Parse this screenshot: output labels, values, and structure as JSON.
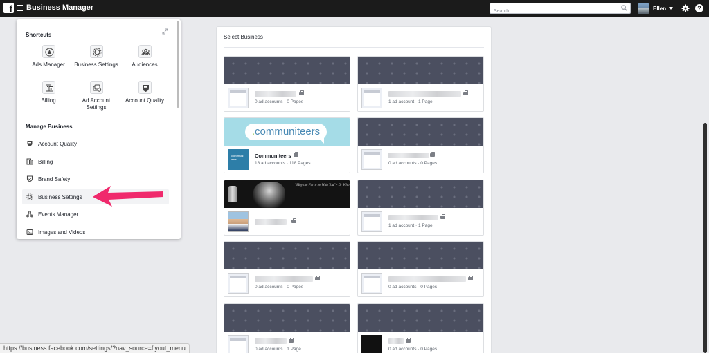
{
  "topbar": {
    "title": "Business Manager",
    "search_placeholder": "Search",
    "user_name": "Ellen",
    "help_glyph": "?"
  },
  "flyout": {
    "shortcuts_heading": "Shortcuts",
    "shortcuts": [
      {
        "label": "Ads Manager",
        "icon": "ads-manager-icon"
      },
      {
        "label": "Business Settings",
        "icon": "gear-icon"
      },
      {
        "label": "Audiences",
        "icon": "people-icon"
      },
      {
        "label": "Billing",
        "icon": "billing-icon"
      },
      {
        "label": "Ad Account Settings",
        "icon": "ad-account-settings-icon"
      },
      {
        "label": "Account Quality",
        "icon": "shield-icon"
      }
    ],
    "manage_heading": "Manage Business",
    "manage_items": [
      {
        "label": "Account Quality",
        "icon": "shield-icon"
      },
      {
        "label": "Billing",
        "icon": "billing-icon"
      },
      {
        "label": "Brand Safety",
        "icon": "brand-safety-icon"
      },
      {
        "label": "Business Settings",
        "icon": "gear-icon"
      },
      {
        "label": "Events Manager",
        "icon": "events-icon"
      },
      {
        "label": "Images and Videos",
        "icon": "image-icon"
      }
    ],
    "highlighted_item": "Business Settings",
    "accent_color": "#f0296c"
  },
  "main": {
    "heading": "Select Business",
    "businesses": [
      {
        "name": "",
        "meta": "0 ad accounts · 0 Pages"
      },
      {
        "name": "",
        "meta": "1 ad account · 1 Page"
      },
      {
        "name": "Communiteers",
        "meta": "18 ad accounts · 118 Pages",
        "cover_text": ".communiteers",
        "logo_text": ".com muni teers"
      },
      {
        "name": "",
        "meta": "0 ad accounts · 0 Pages"
      },
      {
        "name": "",
        "meta": "",
        "cover_text": "\"May the Force be With You\" - Dr Who"
      },
      {
        "name": "",
        "meta": "1 ad account · 1 Page"
      },
      {
        "name": "",
        "meta": "0 ad accounts · 0 Pages"
      },
      {
        "name": "",
        "meta": "0 ad accounts · 0 Pages"
      },
      {
        "name": "",
        "meta": "0 ad accounts · 1 Page"
      },
      {
        "name": "",
        "meta": "0 ad accounts · 0 Pages"
      }
    ]
  },
  "statusbar": {
    "url": "https://business.facebook.com/settings/?nav_source=flyout_menu"
  }
}
